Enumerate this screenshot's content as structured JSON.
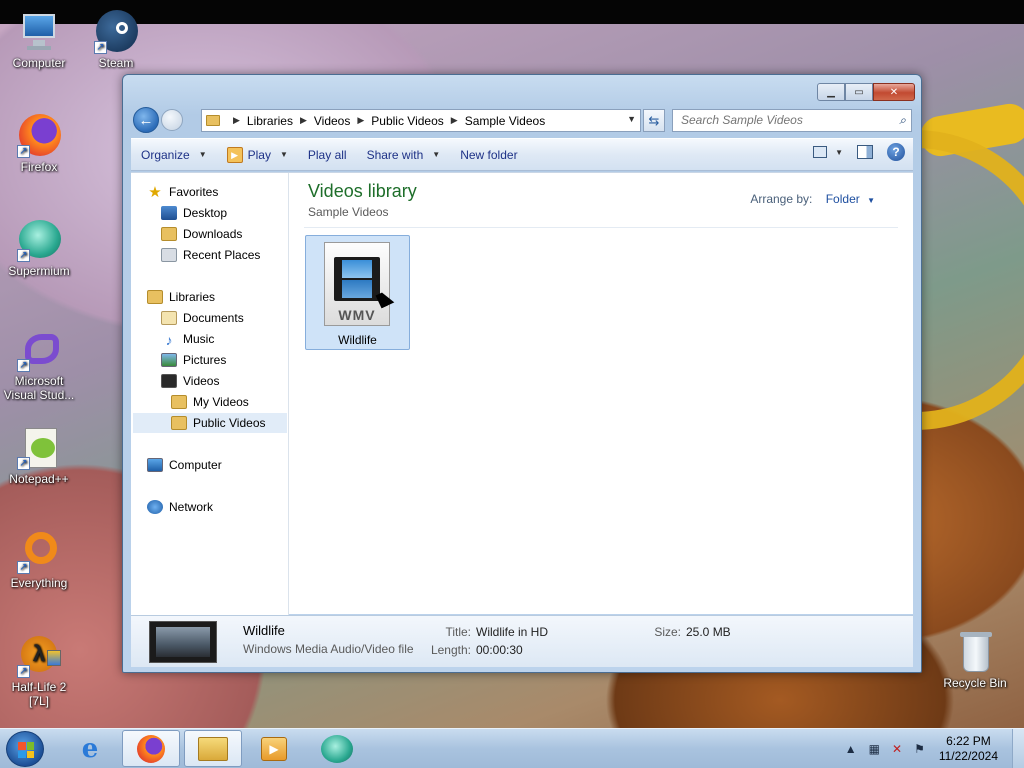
{
  "desktop": {
    "icons": [
      {
        "label": "Computer",
        "icon": "computer-icon"
      },
      {
        "label": "Steam",
        "icon": "steam-icon"
      },
      {
        "label": "Firefox",
        "icon": "firefox-icon"
      },
      {
        "label": "Supermium",
        "icon": "supermium-icon"
      },
      {
        "label": "Microsoft Visual Stud...",
        "icon": "visual-studio-icon"
      },
      {
        "label": "Notepad++",
        "icon": "notepad-plus-plus-icon"
      },
      {
        "label": "Everything",
        "icon": "everything-icon"
      },
      {
        "label": "Half-Life 2 [7L]",
        "icon": "half-life-2-icon"
      },
      {
        "label": "Recycle Bin",
        "icon": "recycle-bin-icon"
      }
    ]
  },
  "window": {
    "breadcrumb": [
      "Libraries",
      "Videos",
      "Public Videos",
      "Sample Videos"
    ],
    "search_placeholder": "Search Sample Videos",
    "toolbar": {
      "organize": "Organize",
      "play": "Play",
      "play_all": "Play all",
      "share_with": "Share with",
      "new_folder": "New folder"
    },
    "nav": {
      "favorites": "Favorites",
      "desktop": "Desktop",
      "downloads": "Downloads",
      "recent_places": "Recent Places",
      "libraries": "Libraries",
      "documents": "Documents",
      "music": "Music",
      "pictures": "Pictures",
      "videos": "Videos",
      "my_videos": "My Videos",
      "public_videos": "Public Videos",
      "computer": "Computer",
      "network": "Network"
    },
    "main": {
      "title": "Videos library",
      "subtitle": "Sample Videos",
      "arrange_label": "Arrange by:",
      "arrange_value": "Folder",
      "files": [
        {
          "name": "Wildlife",
          "badge": "WMV"
        }
      ]
    },
    "details": {
      "name": "Wildlife",
      "type": "Windows Media Audio/Video file",
      "title_label": "Title:",
      "title_value": "Wildlife in HD",
      "length_label": "Length:",
      "length_value": "00:00:30",
      "size_label": "Size:",
      "size_value": "25.0 MB"
    }
  },
  "taskbar": {
    "time": "6:22 PM",
    "date": "11/22/2024"
  },
  "colors": {
    "library_title": "#1e6e2a",
    "command_text": "#1e3287",
    "selection": "#cfe3f8"
  }
}
